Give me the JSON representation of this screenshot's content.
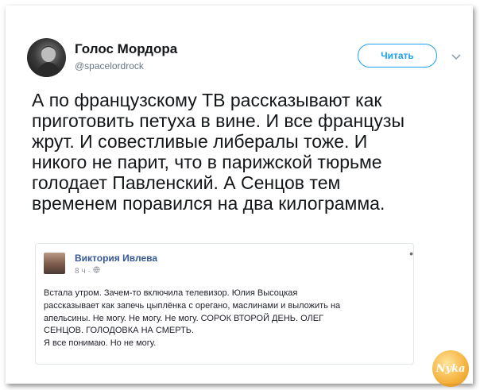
{
  "tweet": {
    "display_name": "Голос Мордора",
    "handle": "@spacelordrock",
    "follow_label": "Читать",
    "text_lines": [
      "А по французскому ТВ рассказывают как",
      "приготовить петуха в вине. И все французы",
      "жрут. И совестливые либералы тоже. И",
      "никого не парит, что в парижской тюрьме",
      "голодает Павленский. А Сенцов тем",
      "временем поравился на два килограмма."
    ]
  },
  "quote": {
    "author": "Виктория Ивлева",
    "time": "8 ч ·",
    "more": "•",
    "text_lines": [
      "Встала утром. Зачем-то включила телевизор. Юлия Высоцкая",
      "рассказывает как запечь цыплёнка с орегано, маслинами и выложить на",
      "апельсины. Не могу. Не могу. Не могу. СОРОК ВТОРОЙ ДЕНЬ. ОЛЕГ",
      "СЕНЦОВ. ГОЛОДОВКА НА СМЕРТЬ.",
      "Я все понимаю. Но не могу."
    ]
  },
  "watermark": {
    "text": "Nyka"
  },
  "colors": {
    "accent": "#1da1f2",
    "fb_name": "#365899",
    "text": "#14171a",
    "muted": "#657786"
  },
  "icons": {
    "chevron": "chevron-down-icon",
    "globe": "globe-icon"
  }
}
